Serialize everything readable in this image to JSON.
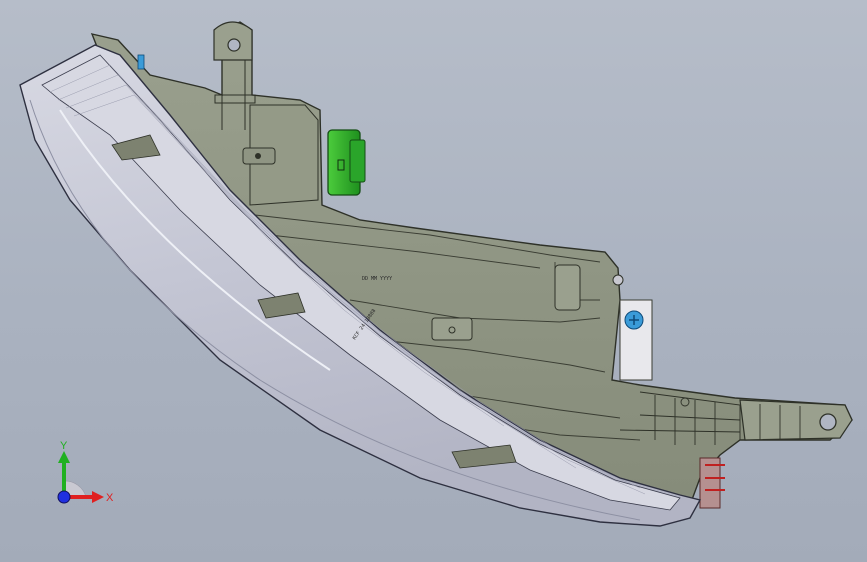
{
  "viewport": {
    "background_top": "#b6bdc9",
    "background_bottom": "#a3abb9"
  },
  "model": {
    "housing_color": "#8f9683",
    "lens_color": "#c9cbd8",
    "connector_color": "#2fb52f",
    "screw_color": "#3a9bd8",
    "date_stamp": "DD MM YYYY",
    "part_stamp": "KCF 24 18888"
  },
  "triad": {
    "x_label": "X",
    "y_label": "Y",
    "x_color": "#e02020",
    "y_color": "#20b020",
    "origin_color": "#2030e0"
  }
}
